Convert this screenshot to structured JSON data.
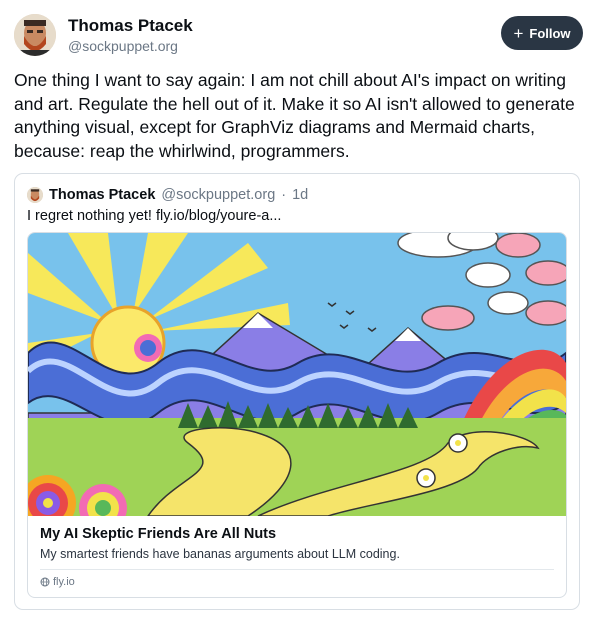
{
  "post": {
    "author_name": "Thomas Ptacek",
    "author_handle": "@sockpuppet.org",
    "follow_label": "Follow",
    "text": "One thing I want to say again: I am not chill about AI's impact on writing and art. Regulate the hell out of it. Make it so AI isn't allowed to generate anything visual, except for GraphViz diagrams and Mermaid charts, because: reap the whirlwind, programmers."
  },
  "quote": {
    "author_name": "Thomas Ptacek",
    "author_handle": "@sockpuppet.org",
    "separator": "·",
    "time": "1d",
    "text": "I regret nothing yet! fly.io/blog/youre-a...",
    "link": {
      "title": "My AI Skeptic Friends Are All Nuts",
      "description": "My smartest friends have bananas arguments about LLM coding.",
      "domain": "fly.io"
    }
  },
  "icons": {
    "follow": "plus-icon",
    "domain": "globe-icon"
  },
  "colors": {
    "follow_button_bg": "#2a3644",
    "text_primary": "#0b0f14",
    "text_secondary": "#6b7785",
    "border": "#d8dee4"
  }
}
